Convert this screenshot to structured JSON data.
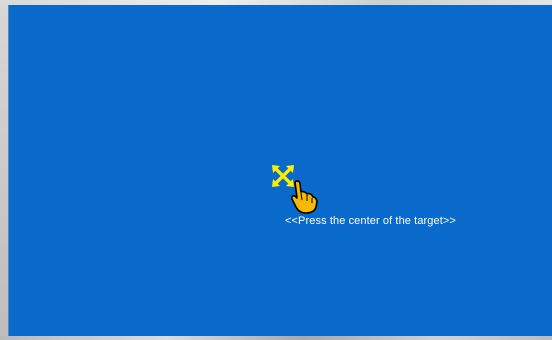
{
  "calibration": {
    "instruction": "<<Press the center of the target>>",
    "target_icon": "crosshair-target-icon",
    "pointer_icon": "hand-pointer-icon"
  },
  "colors": {
    "screen_background": "#0a6acb",
    "target": "#ffee00",
    "pointer": "#f7b800",
    "text": "#ffffff"
  }
}
